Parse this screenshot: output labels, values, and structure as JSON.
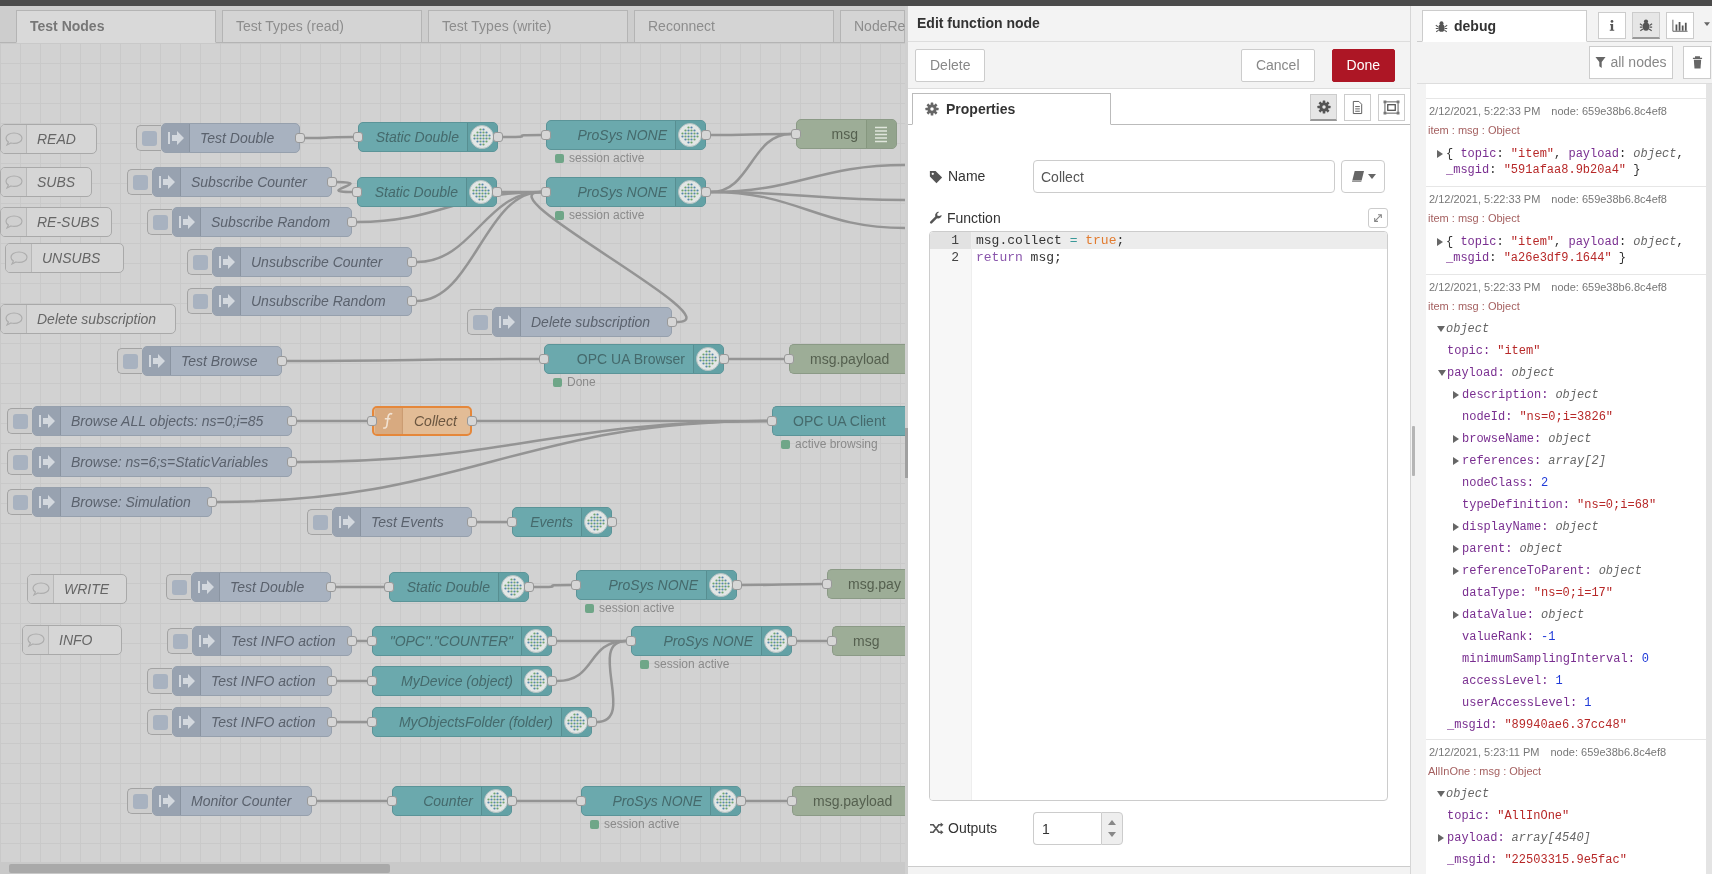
{
  "canvas": {
    "tabs": [
      {
        "label": "Test Nodes",
        "selected": true
      },
      {
        "label": "Test Types (read)",
        "selected": false
      },
      {
        "label": "Test Types (write)",
        "selected": false
      },
      {
        "label": "Reconnect",
        "selected": false
      },
      {
        "label": "NodeRe",
        "selected": false
      }
    ],
    "nodes": [
      {
        "kind": "comment",
        "label": "READ",
        "italic": true,
        "selected": false
      },
      {
        "kind": "inject",
        "label": "Test Double",
        "italic": true,
        "selected": false
      },
      {
        "kind": "opcua",
        "label": "Static Double",
        "italic": true,
        "selected": false
      },
      {
        "kind": "opcua",
        "label": "ProSys NONE",
        "italic": true,
        "selected": false,
        "status": "session active"
      },
      {
        "kind": "debug",
        "label": "msg",
        "italic": false,
        "selected": false
      },
      {
        "kind": "comment",
        "label": "SUBS",
        "italic": true,
        "selected": false
      },
      {
        "kind": "inject",
        "label": "Subscribe Counter",
        "italic": true,
        "selected": false
      },
      {
        "kind": "opcua",
        "label": "Static Double",
        "italic": true,
        "selected": false
      },
      {
        "kind": "opcua",
        "label": "ProSys NONE",
        "italic": true,
        "selected": false,
        "status": "session active"
      },
      {
        "kind": "comment",
        "label": "RE-SUBS",
        "italic": true,
        "selected": false
      },
      {
        "kind": "inject",
        "label": "Subscribe Random",
        "italic": true,
        "selected": false
      },
      {
        "kind": "comment",
        "label": "UNSUBS",
        "italic": true,
        "selected": false
      },
      {
        "kind": "inject",
        "label": "Unsubscribe Counter",
        "italic": true,
        "selected": false
      },
      {
        "kind": "inject",
        "label": "Unsubscribe Random",
        "italic": true,
        "selected": false
      },
      {
        "kind": "comment",
        "label": "Delete subscription",
        "italic": true,
        "selected": false
      },
      {
        "kind": "inject",
        "label": "Delete subscription",
        "italic": true,
        "selected": false
      },
      {
        "kind": "inject",
        "label": "Test Browse",
        "italic": true,
        "selected": false
      },
      {
        "kind": "opcua",
        "label": "OPC UA Browser",
        "italic": false,
        "selected": false,
        "status": "Done"
      },
      {
        "kind": "debug",
        "label": "msg.payload",
        "italic": false,
        "selected": false
      },
      {
        "kind": "inject",
        "label": "Browse ALL objects: ns=0;i=85",
        "italic": true,
        "selected": false
      },
      {
        "kind": "function",
        "label": "Collect",
        "italic": true,
        "selected": true
      },
      {
        "kind": "opcua",
        "label": "OPC UA Client",
        "italic": false,
        "selected": false,
        "status": "active browsing"
      },
      {
        "kind": "inject",
        "label": "Browse: ns=6;s=StaticVariables",
        "italic": true,
        "selected": false
      },
      {
        "kind": "inject",
        "label": "Browse: Simulation",
        "italic": true,
        "selected": false
      },
      {
        "kind": "inject",
        "label": "Test Events",
        "italic": true,
        "selected": false
      },
      {
        "kind": "opcua",
        "label": "Events",
        "italic": true,
        "selected": false
      },
      {
        "kind": "comment",
        "label": "WRITE",
        "italic": true,
        "selected": false
      },
      {
        "kind": "inject",
        "label": "Test Double",
        "italic": true,
        "selected": false
      },
      {
        "kind": "opcua",
        "label": "Static Double",
        "italic": true,
        "selected": false
      },
      {
        "kind": "opcua",
        "label": "ProSys NONE",
        "italic": true,
        "selected": false,
        "status": "session active"
      },
      {
        "kind": "debug",
        "label": "msg.pay",
        "italic": false,
        "selected": false
      },
      {
        "kind": "comment",
        "label": "INFO",
        "italic": true,
        "selected": false
      },
      {
        "kind": "inject",
        "label": "Test INFO action",
        "italic": true,
        "selected": false
      },
      {
        "kind": "opcua",
        "label": "\"OPC\".\"COUNTER\"",
        "italic": true,
        "selected": false
      },
      {
        "kind": "opcua",
        "label": "ProSys NONE",
        "italic": true,
        "selected": false,
        "status": "session active"
      },
      {
        "kind": "debug",
        "label": "msg",
        "italic": false,
        "selected": false
      },
      {
        "kind": "inject",
        "label": "Test INFO action",
        "italic": true,
        "selected": false
      },
      {
        "kind": "opcua",
        "label": "MyDevice (object)",
        "italic": true,
        "selected": false
      },
      {
        "kind": "inject",
        "label": "Test INFO action",
        "italic": true,
        "selected": false
      },
      {
        "kind": "opcua",
        "label": "MyObjectsFolder (folder)",
        "italic": true,
        "selected": false
      },
      {
        "kind": "inject",
        "label": "Monitor Counter",
        "italic": true,
        "selected": false
      },
      {
        "kind": "opcua",
        "label": "Counter",
        "italic": true,
        "selected": false
      },
      {
        "kind": "opcua",
        "label": "ProSys NONE",
        "italic": true,
        "selected": false,
        "status": "session active"
      },
      {
        "kind": "debug",
        "label": "msg.payload",
        "italic": false,
        "selected": false
      }
    ]
  },
  "editor": {
    "title": "Edit function node",
    "buttons": [
      {
        "label": "Delete",
        "kind": "secondary"
      },
      {
        "label": "Cancel",
        "kind": "secondary"
      },
      {
        "label": "Done",
        "kind": "primary"
      }
    ],
    "tabs": [
      {
        "label": "Properties",
        "selected": true
      }
    ],
    "tab_buttons": [
      {
        "kind": "settings",
        "selected": true
      },
      {
        "kind": "description",
        "selected": false
      },
      {
        "kind": "appearance",
        "selected": false
      }
    ],
    "name": {
      "label": "Name",
      "value": "Collect"
    },
    "function": {
      "label": "Function",
      "lines": [
        {
          "number": "1",
          "highlighted": true,
          "tokens": [
            {
              "text": "msg.collect ",
              "kind": "variable"
            },
            {
              "text": "= ",
              "kind": "operator"
            },
            {
              "text": "true",
              "kind": "atom"
            },
            {
              "text": ";",
              "kind": "punct"
            }
          ]
        },
        {
          "number": "2",
          "highlighted": false,
          "tokens": [
            {
              "text": "return ",
              "kind": "keyword"
            },
            {
              "text": "msg;",
              "kind": "variable"
            }
          ]
        }
      ]
    },
    "outputs": {
      "label": "Outputs",
      "value": "1"
    }
  },
  "debug": {
    "tabs": [
      {
        "label": "debug",
        "selected": true
      }
    ],
    "tab_buttons": [
      {
        "kind": "info",
        "selected": false
      },
      {
        "kind": "debug",
        "selected": true
      },
      {
        "kind": "chart",
        "selected": false
      }
    ],
    "filter": "all nodes",
    "messages": [
      {
        "time": "2/12/2021, 5:22:33 PM",
        "node": "node: 659e38b6.8c4ef8",
        "topic": "item : msg : Object",
        "summary": {
          "expanded": false,
          "tokens": [
            {
              "text": "{ ",
              "kind": "punct"
            },
            {
              "text": "topic",
              "kind": "key"
            },
            {
              "text": ": ",
              "kind": "punct"
            },
            {
              "text": "\"item\"",
              "kind": "string"
            },
            {
              "text": ", ",
              "kind": "punct"
            },
            {
              "text": "payload",
              "kind": "key"
            },
            {
              "text": ": ",
              "kind": "punct"
            },
            {
              "text": "object",
              "kind": "type"
            },
            {
              "text": ", ",
              "kind": "punct"
            },
            {
              "text": "_msgid",
              "kind": "key"
            },
            {
              "text": ": ",
              "kind": "punct"
            },
            {
              "text": "\"591afaa8.9b20a4\"",
              "kind": "string"
            },
            {
              "text": " }",
              "kind": "punct"
            }
          ]
        }
      },
      {
        "time": "2/12/2021, 5:22:33 PM",
        "node": "node: 659e38b6.8c4ef8",
        "topic": "item : msg : Object",
        "summary": {
          "expanded": false,
          "tokens": [
            {
              "text": "{ ",
              "kind": "punct"
            },
            {
              "text": "topic",
              "kind": "key"
            },
            {
              "text": ": ",
              "kind": "punct"
            },
            {
              "text": "\"item\"",
              "kind": "string"
            },
            {
              "text": ", ",
              "kind": "punct"
            },
            {
              "text": "payload",
              "kind": "key"
            },
            {
              "text": ": ",
              "kind": "punct"
            },
            {
              "text": "object",
              "kind": "type"
            },
            {
              "text": ", ",
              "kind": "punct"
            },
            {
              "text": "_msgid",
              "kind": "key"
            },
            {
              "text": ": ",
              "kind": "punct"
            },
            {
              "text": "\"a26e3df9.1644\"",
              "kind": "string"
            },
            {
              "text": " }",
              "kind": "punct"
            }
          ]
        }
      },
      {
        "time": "2/12/2021, 5:22:33 PM",
        "node": "node: 659e38b6.8c4ef8",
        "topic": "item : msg : Object",
        "tree": {
          "value": "object",
          "kind": "type",
          "expanded": true,
          "children": [
            {
              "key": "topic:",
              "value": "\"item\"",
              "kind": "string"
            },
            {
              "key": "payload:",
              "value": "object",
              "kind": "type",
              "expanded": true,
              "children": [
                {
                  "key": "description:",
                  "value": "object",
                  "kind": "type",
                  "expanded": false
                },
                {
                  "key": "nodeId:",
                  "value": "\"ns=0;i=3826\"",
                  "kind": "string"
                },
                {
                  "key": "browseName:",
                  "value": "object",
                  "kind": "type",
                  "expanded": false
                },
                {
                  "key": "references:",
                  "value": "array[2]",
                  "kind": "type",
                  "expanded": false
                },
                {
                  "key": "nodeClass:",
                  "value": "2",
                  "kind": "number"
                },
                {
                  "key": "typeDefinition:",
                  "value": "\"ns=0;i=68\"",
                  "kind": "string"
                },
                {
                  "key": "displayName:",
                  "value": "object",
                  "kind": "type",
                  "expanded": false
                },
                {
                  "key": "parent:",
                  "value": "object",
                  "kind": "type",
                  "expanded": false
                },
                {
                  "key": "referenceToParent:",
                  "value": "object",
                  "kind": "type",
                  "expanded": false
                },
                {
                  "key": "dataType:",
                  "value": "\"ns=0;i=17\"",
                  "kind": "string"
                },
                {
                  "key": "dataValue:",
                  "value": "object",
                  "kind": "type",
                  "expanded": false
                },
                {
                  "key": "valueRank:",
                  "value": "-1",
                  "kind": "number"
                },
                {
                  "key": "minimumSamplingInterval:",
                  "value": "0",
                  "kind": "number"
                },
                {
                  "key": "accessLevel:",
                  "value": "1",
                  "kind": "number"
                },
                {
                  "key": "userAccessLevel:",
                  "value": "1",
                  "kind": "number"
                }
              ]
            },
            {
              "key": "_msgid:",
              "value": "\"89940ae6.37cc48\"",
              "kind": "string"
            }
          ]
        }
      },
      {
        "time": "2/12/2021, 5:23:11 PM",
        "node": "node: 659e38b6.8c4ef8",
        "topic": "AllInOne : msg : Object",
        "tree": {
          "value": "object",
          "kind": "type",
          "expanded": true,
          "children": [
            {
              "key": "topic:",
              "value": "\"AllInOne\"",
              "kind": "string"
            },
            {
              "key": "payload:",
              "value": "array[4540]",
              "kind": "type",
              "expanded": false
            },
            {
              "key": "_msgid:",
              "value": "\"22503315.9e5fac\"",
              "kind": "string"
            }
          ]
        }
      }
    ]
  }
}
